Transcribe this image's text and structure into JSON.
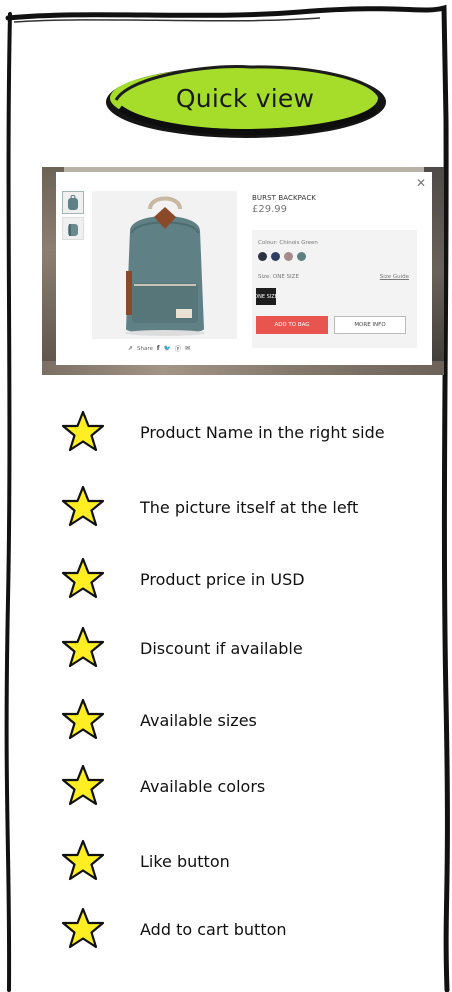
{
  "header": {
    "title": "Quick view"
  },
  "quick_view": {
    "product_name": "BURST BACKPACK",
    "price": "£29.99",
    "colour_label": "Colour: Chinois Green",
    "swatch_colors": [
      "#2c3340",
      "#2f3f63",
      "#a58c8c",
      "#5e8080"
    ],
    "size_label": "Size: ONE SIZE",
    "size_guide": "Size Guide",
    "size_option": "ONE SIZE",
    "add_to_bag": "ADD TO BAG",
    "more_info": "MORE INFO",
    "share_label": "Share",
    "close_icon": "close-icon"
  },
  "features": [
    "Product Name in the right side",
    "The picture itself at the left",
    "Product price in USD",
    "Discount if available",
    "Available sizes",
    "Available colors",
    "Like button",
    "Add to cart button"
  ],
  "colors": {
    "pill_green": "#a6dd2b",
    "star_yellow": "#ffee22",
    "add_button": "#e8554e"
  }
}
